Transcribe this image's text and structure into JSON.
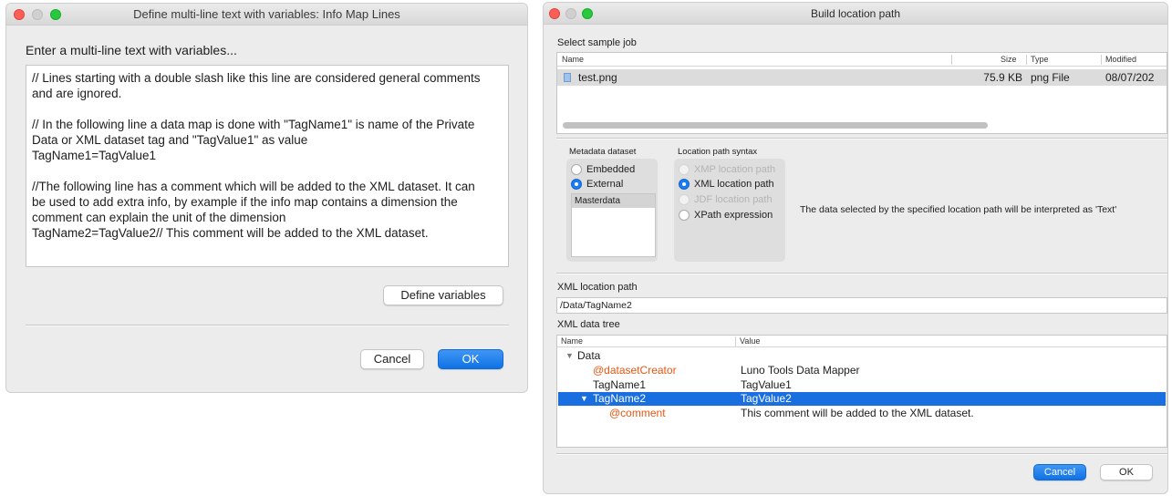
{
  "left_window": {
    "title": "Define multi-line text with variables: Info Map Lines",
    "prompt": "Enter a multi-line text with variables...",
    "text_lines": [
      "// Lines starting with a double slash like this line are considered general comments",
      "and are ignored.",
      "",
      "// In the following line a data map is done with \"TagName1\" is name of the Private",
      "Data or XML dataset tag and \"TagValue1\" as value",
      "TagName1=TagValue1",
      "",
      "//The following line has a comment which will be added to the XML dataset. It can",
      "be used to add extra info, by example if the info map contains a dimension the",
      "comment can explain the unit of the dimension",
      "TagName2=TagValue2// This comment will be added to the XML dataset."
    ],
    "define_variables_label": "Define variables",
    "cancel_label": "Cancel",
    "ok_label": "OK"
  },
  "right_window": {
    "title": "Build location path",
    "sample_job_label": "Select sample job",
    "file_columns": [
      "Name",
      "Size",
      "Type",
      "Modified"
    ],
    "file_rows": [
      {
        "name": "test.png",
        "size": "75.9 KB",
        "type": "png File",
        "modified": "08/07/202"
      }
    ],
    "metadata_dataset": {
      "label": "Metadata dataset",
      "options": [
        "Embedded",
        "External"
      ],
      "selected": "External",
      "list_items": [
        "Masterdata"
      ]
    },
    "location_syntax": {
      "label": "Location path syntax",
      "options": [
        {
          "label": "XMP location path",
          "state": "disabled"
        },
        {
          "label": "XML location path",
          "state": "selected"
        },
        {
          "label": "JDF location path",
          "state": "disabled"
        },
        {
          "label": "XPath expression",
          "state": "enabled"
        }
      ]
    },
    "interpret_note": "The data selected by the specified location path will be interpreted as 'Text'",
    "xml_path_label": "XML location path",
    "xml_path_value": "/Data/TagName2",
    "tree_label": "XML data tree",
    "tree_columns": [
      "Name",
      "Value"
    ],
    "tree_rows": [
      {
        "name": "Data",
        "value": "",
        "kind": "element",
        "expanded": true
      },
      {
        "name": "@datasetCreator",
        "value": "Luno Tools Data Mapper",
        "kind": "attribute"
      },
      {
        "name": "TagName1",
        "value": "TagValue1",
        "kind": "element"
      },
      {
        "name": "TagName2",
        "value": "TagValue2",
        "kind": "element",
        "expanded": true,
        "selected": true
      },
      {
        "name": "@comment",
        "value": "This comment will be added to the XML dataset.",
        "kind": "attribute"
      }
    ],
    "cancel_label": "Cancel",
    "ok_label": "OK"
  },
  "colors": {
    "accent": "#1a6fe0",
    "attribute": "#e8560f",
    "selection": "#1a6fe0"
  }
}
